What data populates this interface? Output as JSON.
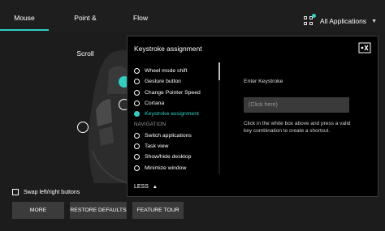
{
  "tabs": [
    {
      "label": "Mouse"
    },
    {
      "label": "Point & Scroll"
    },
    {
      "label": "Flow"
    }
  ],
  "app_selector": {
    "label": "All Applications",
    "icon": "apps-grid-icon"
  },
  "panel": {
    "title": "Keystroke assignment",
    "close_icon": "close-panel-icon",
    "list_items": [
      {
        "label": "Wheel mode shift",
        "selected": false
      },
      {
        "label": "Gesture button",
        "selected": false
      },
      {
        "label": "Change Pointer Speed",
        "selected": false
      },
      {
        "label": "Cortana",
        "selected": false
      },
      {
        "label": "Keystroke assignment",
        "selected": true
      }
    ],
    "nav_heading": "NAVIGATION",
    "nav_items": [
      {
        "label": "Switch applications"
      },
      {
        "label": "Task view"
      },
      {
        "label": "Show/hide desktop"
      },
      {
        "label": "Minimize window"
      }
    ],
    "less_label": "LESS",
    "enter_keystroke_label": "Enter Keystroke",
    "keystroke_placeholder": "(Click here)",
    "help_text": "Click in the white box above and press a valid key combination to create a shortcut."
  },
  "swap_label": "Swap left/right buttons",
  "buttons": {
    "more": "MORE",
    "restore": "RESTORE DEFAULTS",
    "tour": "FEATURE TOUR"
  },
  "colors": {
    "accent": "#2fd0c4",
    "background": "#1c1c1c",
    "panel": "#000000"
  }
}
